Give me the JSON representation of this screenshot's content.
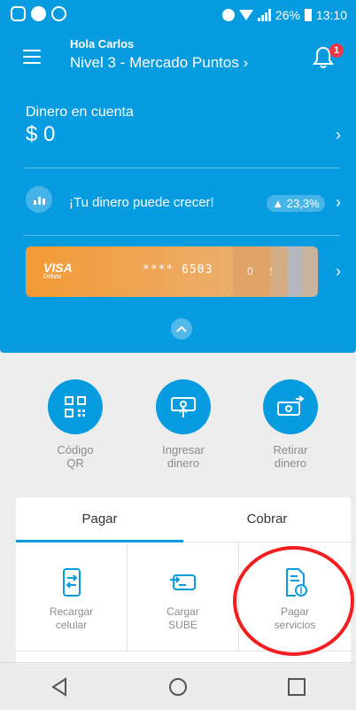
{
  "status_bar": {
    "battery": "26%",
    "time": "13:10",
    "icons": [
      "instagram-icon",
      "facebook-icon",
      "whatsapp-icon",
      "bluetooth-icon",
      "wifi-icon",
      "signal-icon",
      "battery-icon"
    ]
  },
  "header": {
    "greeting": "Hola Carlos",
    "level": "Nivel 3 - Mercado Puntos ›",
    "notification_count": "1"
  },
  "balance": {
    "label": "Dinero en cuenta",
    "value": "$ 0"
  },
  "growth": {
    "text": "¡Tu dinero puede crecer!",
    "rate": "▲ 23,3%"
  },
  "card": {
    "brand": "VISA",
    "type": "Débito",
    "number": "**** 6503",
    "back_digits": [
      "0",
      "2",
      "0",
      "3"
    ]
  },
  "shortcuts": [
    {
      "label": "Código\nQR"
    },
    {
      "label": "Ingresar\ndinero"
    },
    {
      "label": "Retirar\ndinero"
    }
  ],
  "tabs": [
    {
      "label": "Pagar"
    },
    {
      "label": "Cobrar"
    }
  ],
  "services": [
    {
      "label": "Recargar\ncelular"
    },
    {
      "label": "Cargar\nSUBE"
    },
    {
      "label": "Pagar\nservicios"
    }
  ],
  "colors": {
    "brand_blue": "#079be0",
    "card_orange": "#f29a34",
    "highlight_red": "#f41e1e",
    "badge_red": "#f0384a"
  }
}
